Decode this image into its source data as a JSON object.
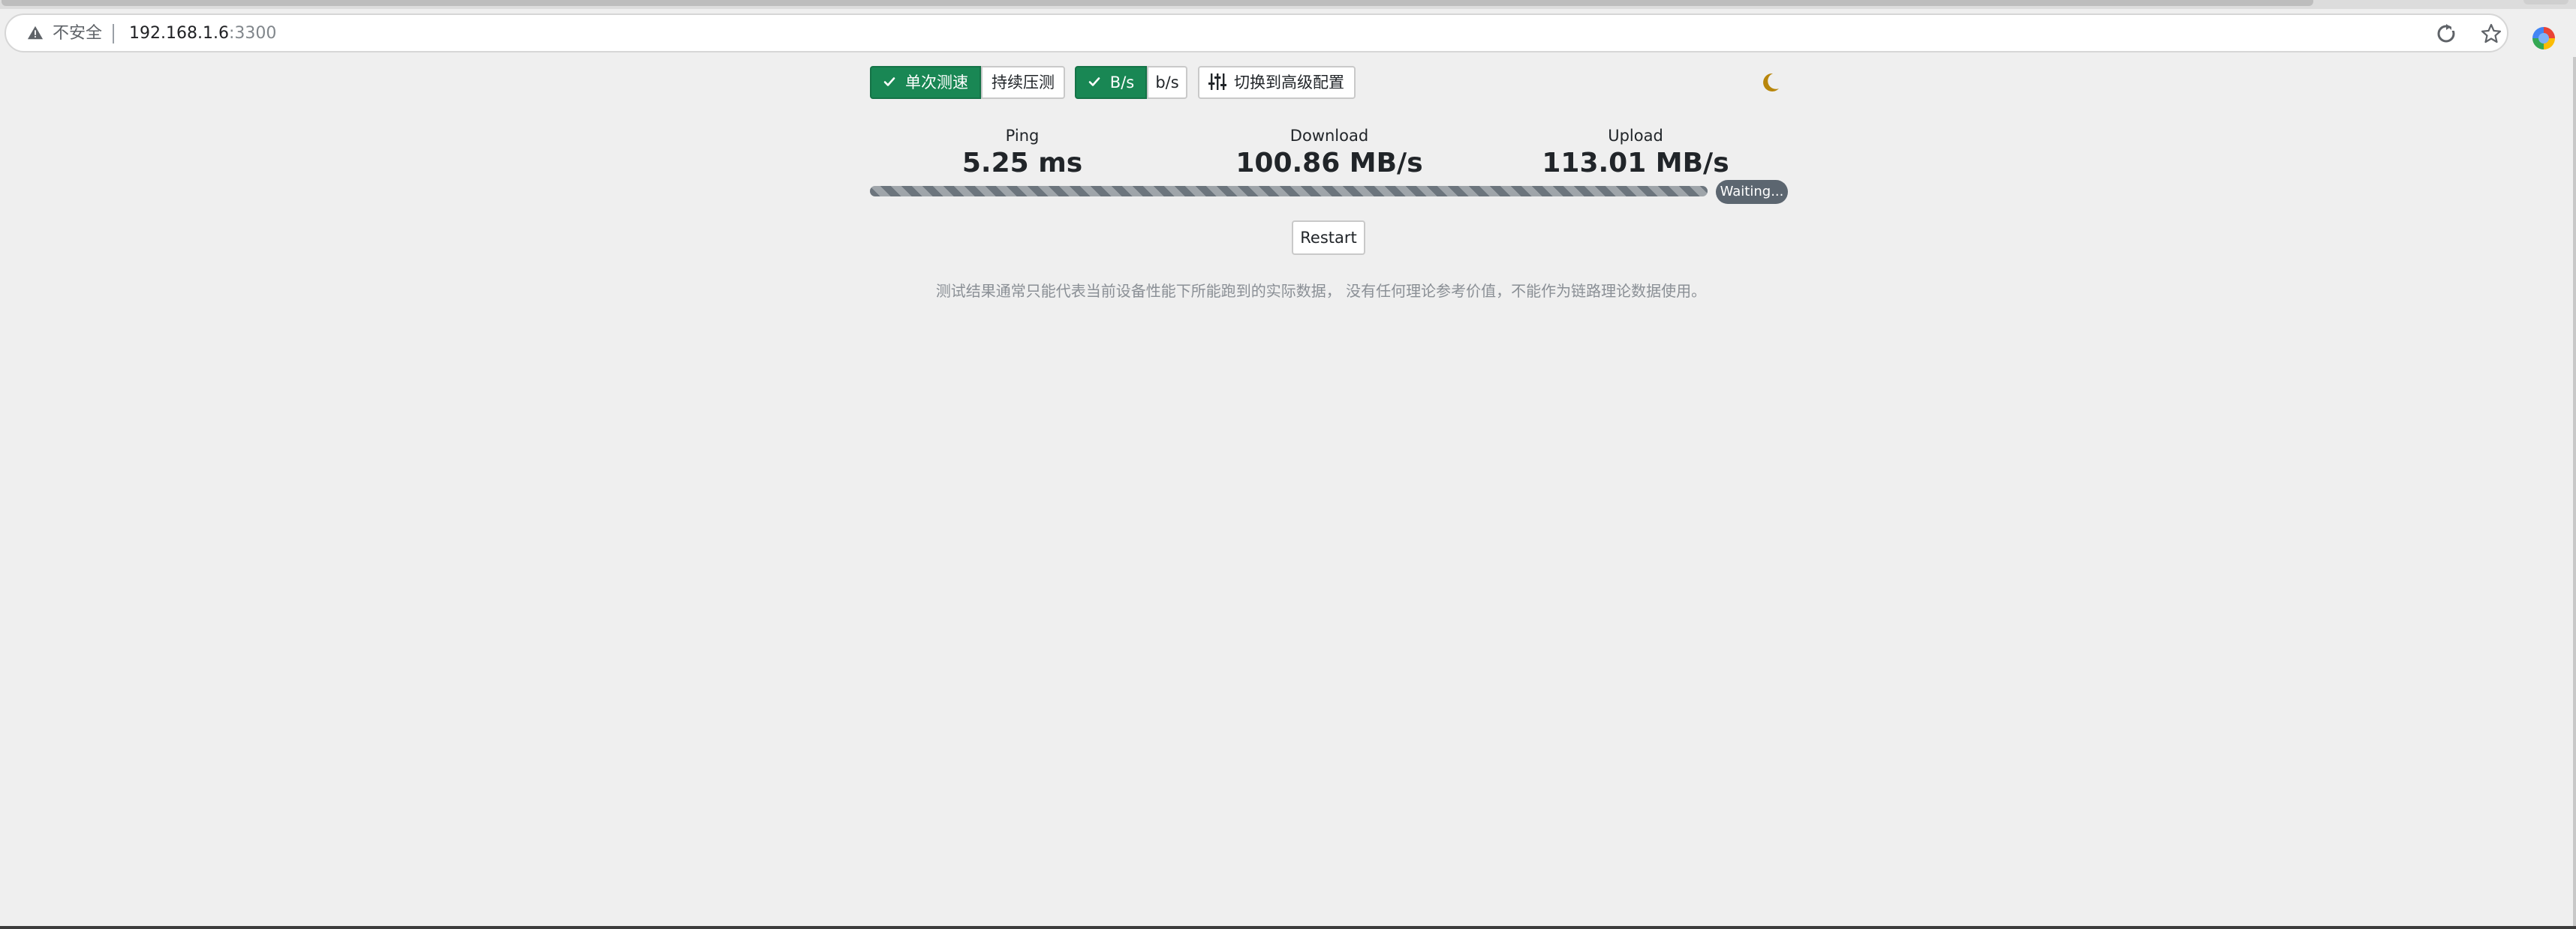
{
  "browser": {
    "security_label": "不安全",
    "url_host": "192.168.1.6",
    "url_port": ":3300"
  },
  "controls": {
    "single_test_label": "单次测速",
    "continuous_test_label": "持续压测",
    "single_test_active": true,
    "bytes_unit_label": "B/s",
    "bits_unit_label": "b/s",
    "bytes_unit_active": true,
    "advanced_label": "切换到高级配置"
  },
  "stats": {
    "ping_label": "Ping",
    "ping_value": "5.25 ms",
    "download_label": "Download",
    "download_value": "100.86 MB/s",
    "upload_label": "Upload",
    "upload_value": "113.01 MB/s"
  },
  "progress": {
    "fraction": 1.0,
    "status": "Waiting..."
  },
  "restart_label": "Restart",
  "disclaimer": "测试结果通常只能代表当前设备性能下所能跑到的实际数据， 没有任何理论参考价值，不能作为链路理论数据使用。",
  "colors": {
    "accent": "#198754",
    "progress_bar": "#6c757d",
    "badge": "#5c6670",
    "moon": "#b8860b"
  },
  "icons": {
    "security": "warning-triangle-icon",
    "refresh": "refresh-icon",
    "bookmark": "star-icon",
    "profile": "profile-icon",
    "check": "check-icon",
    "advanced": "sliders-icon",
    "theme": "moon-icon"
  }
}
